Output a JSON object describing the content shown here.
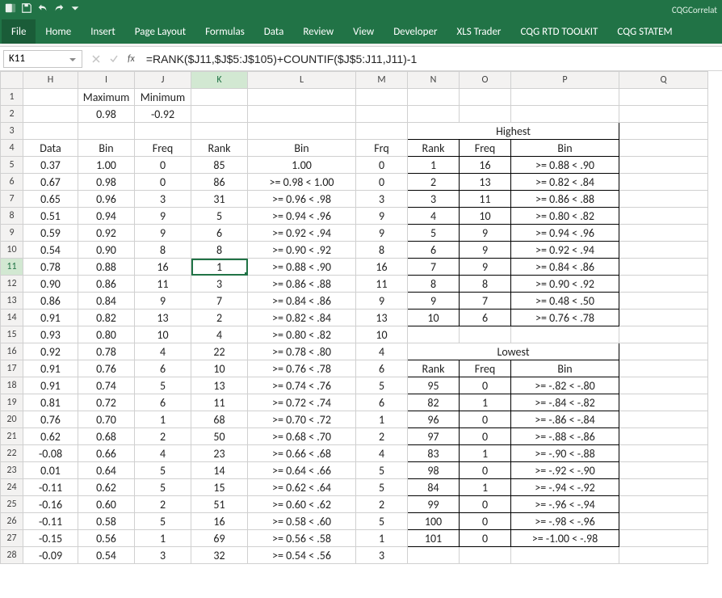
{
  "app": {
    "document_name": "CQGCorrelat",
    "qat_icons": [
      "excel-icon",
      "save-icon",
      "undo-icon",
      "redo-icon",
      "customize-icon"
    ]
  },
  "ribbon": {
    "tabs": [
      "File",
      "Home",
      "Insert",
      "Page Layout",
      "Formulas",
      "Data",
      "Review",
      "View",
      "Developer",
      "XLS Trader",
      "CQG RTD TOOLKIT",
      "CQG STATEM"
    ]
  },
  "name_box": "K11",
  "fx_label": "fx",
  "formula": "=RANK($J11,$J$5:J$105)+COUNTIF($J$5:J11,J11)-1",
  "columns": [
    "H",
    "I",
    "J",
    "K",
    "L",
    "M",
    "N",
    "O",
    "P",
    "Q"
  ],
  "headers": {
    "r1": {
      "I": "Maximum",
      "J": "Minimum"
    },
    "r2": {
      "I": "0.98",
      "J": "-0.92"
    },
    "r3": {
      "NOP_title": "Highest"
    },
    "r4": {
      "H": "Data",
      "I": "Bin",
      "J": "Freq",
      "K": "Rank",
      "L": "Bin",
      "M": "Frq",
      "N": "Rank",
      "O": "Freq",
      "P": "Bin"
    },
    "r16_NOP_title": "Lowest",
    "r17": {
      "N": "Rank",
      "O": "Freq",
      "P": "Bin"
    }
  },
  "rows": [
    {
      "n": 5,
      "H": "0.37",
      "I": "1.00",
      "J": "0",
      "K": "85",
      "L": "1.00",
      "M": "0",
      "N": "1",
      "O": "16",
      "P": ">= 0.88 < .90"
    },
    {
      "n": 6,
      "H": "0.67",
      "I": "0.98",
      "J": "0",
      "K": "86",
      "L": ">= 0.98 < 1.00",
      "M": "0",
      "N": "2",
      "O": "13",
      "P": ">= 0.82 < .84"
    },
    {
      "n": 7,
      "H": "0.65",
      "I": "0.96",
      "J": "3",
      "K": "31",
      "L": ">= 0.96 < .98",
      "M": "3",
      "N": "3",
      "O": "11",
      "P": ">= 0.86 < .88"
    },
    {
      "n": 8,
      "H": "0.51",
      "I": "0.94",
      "J": "9",
      "K": "5",
      "L": ">= 0.94 < .96",
      "M": "9",
      "N": "4",
      "O": "10",
      "P": ">= 0.80 < .82"
    },
    {
      "n": 9,
      "H": "0.59",
      "I": "0.92",
      "J": "9",
      "K": "6",
      "L": ">= 0.92 < .94",
      "M": "9",
      "N": "5",
      "O": "9",
      "P": ">= 0.94 < .96"
    },
    {
      "n": 10,
      "H": "0.54",
      "I": "0.90",
      "J": "8",
      "K": "8",
      "L": ">= 0.90 < .92",
      "M": "8",
      "N": "6",
      "O": "9",
      "P": ">= 0.92 < .94"
    },
    {
      "n": 11,
      "H": "0.78",
      "I": "0.88",
      "J": "16",
      "K": "1",
      "L": ">= 0.88 < .90",
      "M": "16",
      "N": "7",
      "O": "9",
      "P": ">= 0.84 < .86"
    },
    {
      "n": 12,
      "H": "0.90",
      "I": "0.86",
      "J": "11",
      "K": "3",
      "L": ">= 0.86 < .88",
      "M": "11",
      "N": "8",
      "O": "8",
      "P": ">= 0.90 < .92"
    },
    {
      "n": 13,
      "H": "0.86",
      "I": "0.84",
      "J": "9",
      "K": "7",
      "L": ">= 0.84 < .86",
      "M": "9",
      "N": "9",
      "O": "7",
      "P": ">= 0.48 < .50"
    },
    {
      "n": 14,
      "H": "0.91",
      "I": "0.82",
      "J": "13",
      "K": "2",
      "L": ">= 0.82 < .84",
      "M": "13",
      "N": "10",
      "O": "6",
      "P": ">= 0.76 < .78"
    },
    {
      "n": 15,
      "H": "0.93",
      "I": "0.80",
      "J": "10",
      "K": "4",
      "L": ">= 0.80 < .82",
      "M": "10"
    },
    {
      "n": 16,
      "H": "0.92",
      "I": "0.78",
      "J": "4",
      "K": "22",
      "L": ">= 0.78 < .80",
      "M": "4",
      "NOP_title": "Lowest"
    },
    {
      "n": 17,
      "H": "0.91",
      "I": "0.76",
      "J": "6",
      "K": "10",
      "L": ">= 0.76 < .78",
      "M": "6",
      "N": "Rank",
      "O": "Freq",
      "P": "Bin",
      "is_header_nop": true
    },
    {
      "n": 18,
      "H": "0.91",
      "I": "0.74",
      "J": "5",
      "K": "13",
      "L": ">= 0.74 < .76",
      "M": "5",
      "N": "95",
      "O": "0",
      "P": ">= -.82 < -.80"
    },
    {
      "n": 19,
      "H": "0.81",
      "I": "0.72",
      "J": "6",
      "K": "11",
      "L": ">= 0.72 < .74",
      "M": "6",
      "N": "82",
      "O": "1",
      "P": ">= -.84 < -.82"
    },
    {
      "n": 20,
      "H": "0.76",
      "I": "0.70",
      "J": "1",
      "K": "68",
      "L": ">= 0.70 < .72",
      "M": "1",
      "N": "96",
      "O": "0",
      "P": ">= -.86 < -.84"
    },
    {
      "n": 21,
      "H": "0.62",
      "I": "0.68",
      "J": "2",
      "K": "50",
      "L": ">= 0.68 < .70",
      "M": "2",
      "N": "97",
      "O": "0",
      "P": ">= -.88 < -.86"
    },
    {
      "n": 22,
      "H": "-0.08",
      "I": "0.66",
      "J": "4",
      "K": "23",
      "L": ">= 0.66 < .68",
      "M": "4",
      "N": "83",
      "O": "1",
      "P": ">= -.90 < -.88"
    },
    {
      "n": 23,
      "H": "0.01",
      "I": "0.64",
      "J": "5",
      "K": "14",
      "L": ">= 0.64 < .66",
      "M": "5",
      "N": "98",
      "O": "0",
      "P": ">= -.92 < -.90"
    },
    {
      "n": 24,
      "H": "-0.11",
      "I": "0.62",
      "J": "5",
      "K": "15",
      "L": ">= 0.62 < .64",
      "M": "5",
      "N": "84",
      "O": "1",
      "P": ">= -.94 < -.92"
    },
    {
      "n": 25,
      "H": "-0.16",
      "I": "0.60",
      "J": "2",
      "K": "51",
      "L": ">= 0.60 < .62",
      "M": "2",
      "N": "99",
      "O": "0",
      "P": ">= -.96 < -.94"
    },
    {
      "n": 26,
      "H": "-0.11",
      "I": "0.58",
      "J": "5",
      "K": "16",
      "L": ">= 0.58 < .60",
      "M": "5",
      "N": "100",
      "O": "0",
      "P": ">= -.98 < -.96"
    },
    {
      "n": 27,
      "H": "-0.15",
      "I": "0.56",
      "J": "1",
      "K": "69",
      "L": ">= 0.56 < .58",
      "M": "1",
      "N": "101",
      "O": "0",
      "P": ">= -1.00 < -.98"
    },
    {
      "n": 28,
      "H": "-0.09",
      "I": "0.54",
      "J": "3",
      "K": "32",
      "L": ">= 0.54 < .56",
      "M": "3"
    }
  ],
  "selection": {
    "cell": "K11",
    "row": 11,
    "col": "K"
  }
}
